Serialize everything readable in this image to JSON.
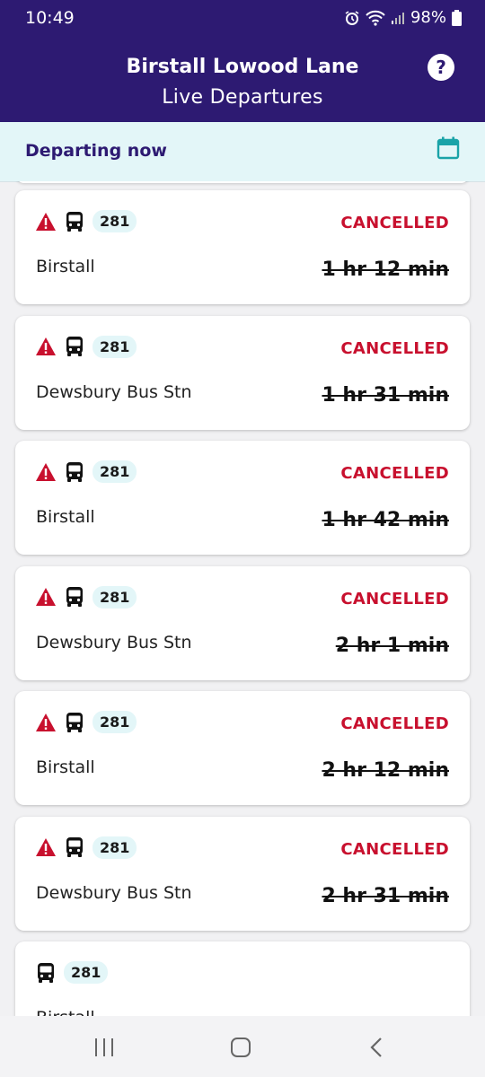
{
  "status_bar": {
    "time": "10:49",
    "battery": "98%"
  },
  "header": {
    "title": "Birstall Lowood Lane",
    "subtitle": "Live Departures",
    "help_label": "?"
  },
  "subheader": {
    "label": "Departing now"
  },
  "departures": [
    {
      "route": "281",
      "status": "CANCELLED",
      "destination": "Birstall",
      "time": "1 hr 12 min",
      "warning": true
    },
    {
      "route": "281",
      "status": "CANCELLED",
      "destination": "Dewsbury Bus Stn",
      "time": "1 hr 31 min",
      "warning": true
    },
    {
      "route": "281",
      "status": "CANCELLED",
      "destination": "Birstall",
      "time": "1 hr 42 min",
      "warning": true
    },
    {
      "route": "281",
      "status": "CANCELLED",
      "destination": "Dewsbury Bus Stn",
      "time": "2 hr 1 min",
      "warning": true
    },
    {
      "route": "281",
      "status": "CANCELLED",
      "destination": "Birstall",
      "time": "2 hr 12 min",
      "warning": true
    },
    {
      "route": "281",
      "status": "CANCELLED",
      "destination": "Dewsbury Bus Stn",
      "time": "2 hr 31 min",
      "warning": true
    },
    {
      "route": "281",
      "status": "",
      "destination": "Birstall",
      "time": "",
      "warning": false
    }
  ],
  "colors": {
    "brand": "#2d1a72",
    "accent": "#1aa3a8",
    "cancelled": "#c8102e"
  },
  "icons": [
    "alarm-icon",
    "wifi-icon",
    "signal-icon",
    "battery-icon",
    "help-icon",
    "calendar-icon",
    "warning-icon",
    "bus-icon",
    "recents-icon",
    "home-icon",
    "back-icon"
  ]
}
